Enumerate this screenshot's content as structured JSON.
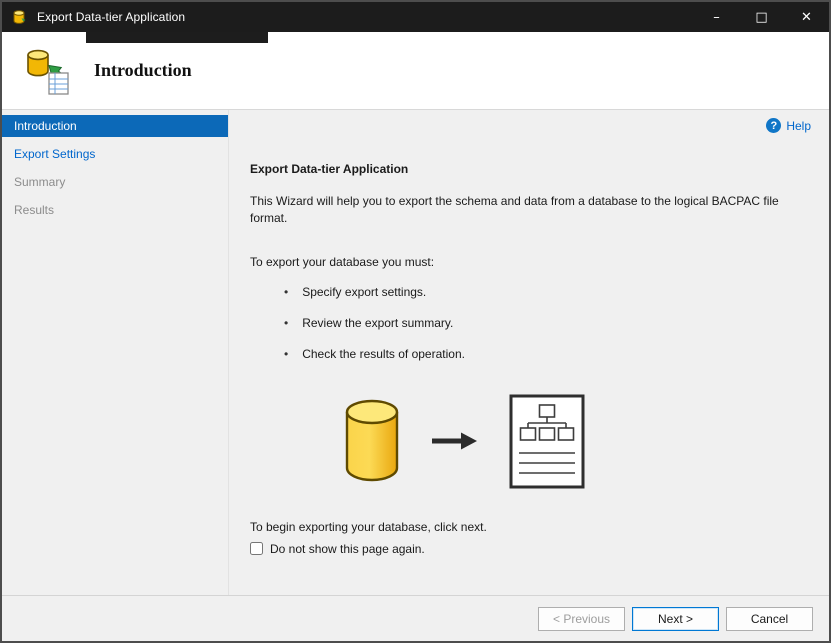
{
  "window": {
    "title": "Export Data-tier Application",
    "controls": {
      "minimize": "–",
      "maximize": "□",
      "close": "✕"
    }
  },
  "header": {
    "title": "Introduction"
  },
  "sidebar": {
    "items": [
      {
        "label": "Introduction",
        "state": "selected"
      },
      {
        "label": "Export Settings",
        "state": "link"
      },
      {
        "label": "Summary",
        "state": "disabled"
      },
      {
        "label": "Results",
        "state": "disabled"
      }
    ]
  },
  "main": {
    "help_label": "Help",
    "help_glyph": "?",
    "title": "Export Data-tier Application",
    "intro_text": "This Wizard will help you to export the schema and data from a database to the logical BACPAC file format.",
    "requirements_intro": "To export your database you must:",
    "bullet_glyph": "•",
    "bullets": [
      "Specify export settings.",
      "Review the export summary.",
      "Check the results of operation."
    ],
    "footer_text": "To begin exporting your database, click next.",
    "checkbox_label": "Do not show this page again."
  },
  "buttons": {
    "previous": "< Previous",
    "next": "Next >",
    "cancel": "Cancel"
  },
  "icons": {
    "app": "database-export-icon",
    "header": "database-export-icon",
    "graphic_left": "database-cylinder",
    "graphic_middle": "right-arrow",
    "graphic_right": "bacpac-schema-document"
  },
  "colors": {
    "titlebar_bg": "#1c1c1c",
    "selected_blue": "#0c69b8",
    "link_blue": "#0066cc",
    "default_button_border": "#0078d4",
    "database_yellow": "#f5c518"
  }
}
